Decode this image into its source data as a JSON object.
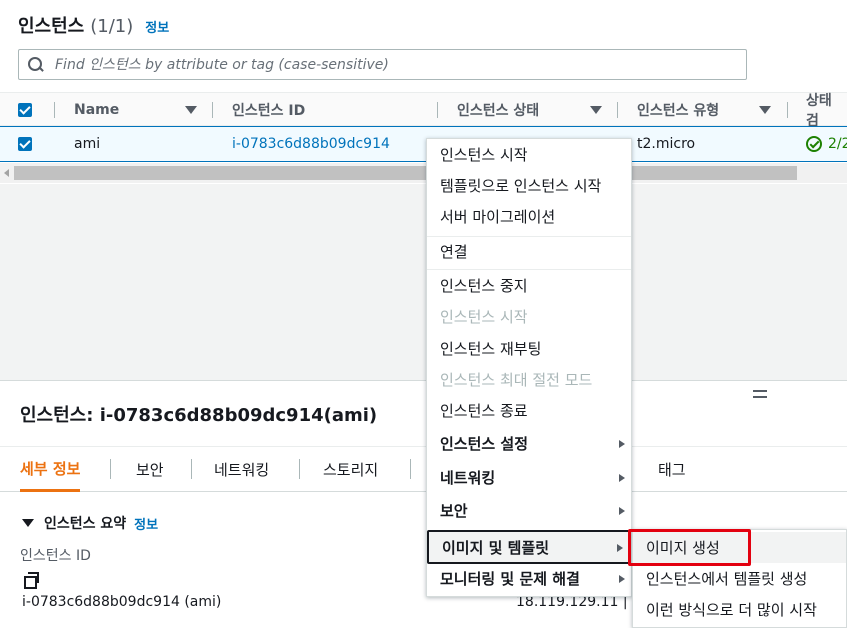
{
  "header": {
    "title": "인스턴스",
    "count": "(1/1)",
    "info": "정보"
  },
  "search": {
    "placeholder": "Find 인스턴스 by attribute or tag (case-sensitive)"
  },
  "table": {
    "columns": [
      "Name",
      "인스턴스 ID",
      "인스턴스 상태",
      "인스턴스 유형",
      "상태 검"
    ],
    "rows": [
      {
        "name": "ami",
        "instance_id": "i-0783c6d88b09dc914",
        "instance_type": "t2.micro",
        "status_check": "2/2"
      }
    ]
  },
  "details": {
    "title": "인스턴스: i-0783c6d88b09dc914(ami)",
    "tabs": [
      "세부 정보",
      "보안",
      "네트워킹",
      "스토리지",
      "태그"
    ],
    "summary_title": "인스턴스 요약",
    "summary_info": "정보",
    "field_label": "인스턴스 ID",
    "field_value": "i-0783c6d88b09dc914 (ami)",
    "ip_value": "18.119.129.11 |"
  },
  "context_menu": {
    "items": [
      {
        "label": "인스턴스 시작",
        "state": "enabled"
      },
      {
        "label": "템플릿으로 인스턴스 시작",
        "state": "enabled"
      },
      {
        "label": "서버 마이그레이션",
        "state": "enabled"
      },
      {
        "label": "연결",
        "state": "enabled"
      },
      {
        "label": "인스턴스 중지",
        "state": "enabled"
      },
      {
        "label": "인스턴스 시작",
        "state": "disabled"
      },
      {
        "label": "인스턴스 재부팅",
        "state": "enabled"
      },
      {
        "label": "인스턴스 최대 절전 모드",
        "state": "disabled"
      },
      {
        "label": "인스턴스 종료",
        "state": "enabled"
      },
      {
        "label": "인스턴스 설정",
        "state": "submenu"
      },
      {
        "label": "네트워킹",
        "state": "submenu"
      },
      {
        "label": "보안",
        "state": "submenu"
      },
      {
        "label": "이미지 및 템플릿",
        "state": "submenu-open"
      },
      {
        "label": "모니터링 및 문제 해결",
        "state": "submenu"
      }
    ]
  },
  "submenu": {
    "items": [
      "이미지 생성",
      "인스턴스에서 템플릿 생성",
      "이런 방식으로 더 많이 시작"
    ]
  },
  "colors": {
    "link": "#0073bb",
    "active_tab": "#ec7211",
    "success": "#1d8102",
    "highlight_box": "#e3000f"
  }
}
